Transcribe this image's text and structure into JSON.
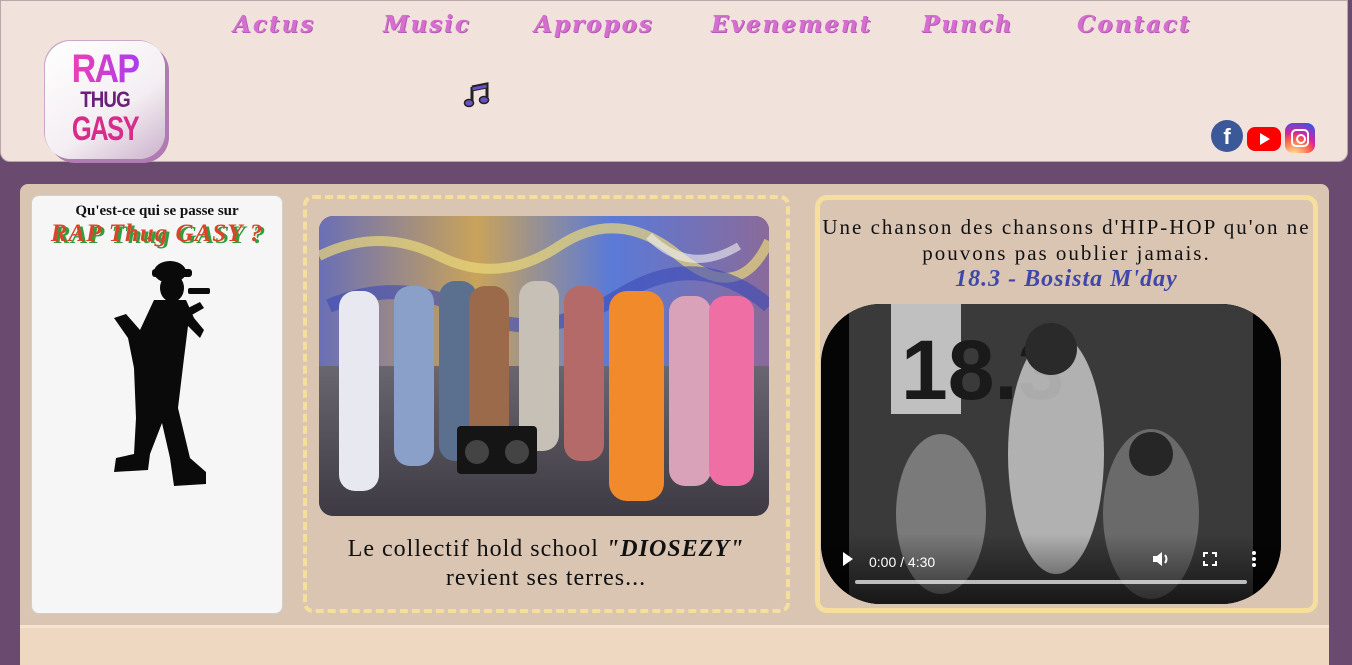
{
  "nav": {
    "items": [
      {
        "label": "Actus"
      },
      {
        "label": "Music"
      },
      {
        "label": "Apropos"
      },
      {
        "label": "Evenement"
      },
      {
        "label": "Punch"
      },
      {
        "label": "Contact"
      }
    ]
  },
  "logo": {
    "line1": "RAP",
    "line2": "THUG",
    "line3": "GASY"
  },
  "icons": {
    "music_note": "music-note-icon",
    "facebook": "facebook-icon",
    "youtube": "youtube-icon",
    "instagram": "instagram-icon"
  },
  "left_panel": {
    "question": "Qu'est-ce qui se passe sur",
    "title": "RAP Thug GASY ?"
  },
  "middle_panel": {
    "caption_prefix": "Le collectif hold school ",
    "caption_name": "\"DIOSEZY\"",
    "caption_suffix": " revient ses terres..."
  },
  "right_panel": {
    "text": "Une chanson des chansons d'HIP-HOP qu'on ne pouvons pas oublier jamais.",
    "song": "18.3 - Bosista M'day",
    "video": {
      "time": "0:00 / 4:30",
      "cover_text": "18.3"
    }
  },
  "colors": {
    "nav": "#d46fd0",
    "page_bg": "#6b4a6f",
    "header_bg": "#f1e3dc",
    "panel_bg": "#dac5b3",
    "accent_border": "#f6df9c",
    "song_color": "#3f48a8"
  }
}
